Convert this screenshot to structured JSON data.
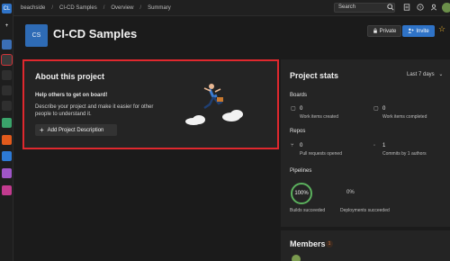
{
  "rail": {
    "items": [
      {
        "icon": "org-icon",
        "text": "CL",
        "color": "#2f73c7"
      },
      {
        "icon": "add-icon",
        "text": "+",
        "color": "#1e1e1e"
      },
      {
        "icon": "overview-icon",
        "text": "",
        "color": "#3b6fb6"
      },
      {
        "icon": "boards-icon",
        "text": "",
        "color": "#3a3a3a"
      },
      {
        "icon": "summary-icon",
        "text": "",
        "color": "#2f2f2f"
      },
      {
        "icon": "dashboards-icon",
        "text": "",
        "color": "#2f2f2f"
      },
      {
        "icon": "wiki-icon",
        "text": "",
        "color": "#2f2f2f"
      },
      {
        "icon": "boards-app-icon",
        "text": "",
        "color": "#3aa36a"
      },
      {
        "icon": "repos-icon",
        "text": "",
        "color": "#e25a1c"
      },
      {
        "icon": "pipelines-icon",
        "text": "",
        "color": "#2d7ad6"
      },
      {
        "icon": "test-plans-icon",
        "text": "",
        "color": "#9f56c8"
      },
      {
        "icon": "artifacts-icon",
        "text": "",
        "color": "#c23b8f"
      }
    ]
  },
  "topbar": {
    "breadcrumbs": [
      "beachside",
      "CI-CD Samples",
      "Overview",
      "Summary"
    ],
    "search_placeholder": "Search"
  },
  "project": {
    "logo_text": "CS",
    "title": "CI-CD Samples",
    "private_label": "Private",
    "invite_label": "Invite"
  },
  "about": {
    "title": "About this project",
    "subtitle": "Help others to get on board!",
    "description": "Describe your project and make it easier for other people to understand it.",
    "add_button": "Add Project Description"
  },
  "stats": {
    "title": "Project stats",
    "range": "Last 7 days",
    "boards": {
      "label": "Boards",
      "created_value": "0",
      "created_label": "Work items created",
      "completed_value": "0",
      "completed_label": "Work items completed"
    },
    "repos": {
      "label": "Repos",
      "pr_value": "0",
      "pr_label": "Pull requests opened",
      "commits_value": "1",
      "commits_label": "Commits by 1 authors"
    },
    "pipelines": {
      "label": "Pipelines",
      "builds_value": "100%",
      "builds_label": "Builds succeeded",
      "deploy_value": "0%",
      "deploy_label": "Deployments succeeded"
    }
  },
  "members": {
    "title": "Members",
    "count": "1"
  }
}
